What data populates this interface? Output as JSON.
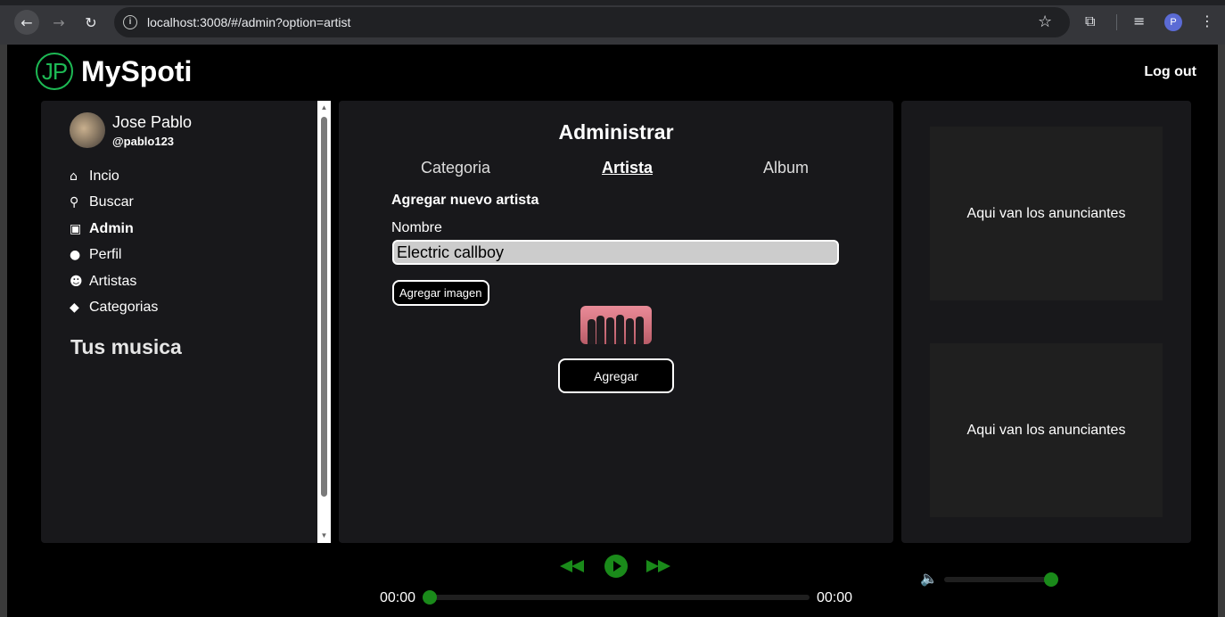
{
  "browser": {
    "url": "localhost:3008/#/admin?option=artist",
    "profile_initial": "P"
  },
  "app": {
    "title": "MySpoti",
    "logo_text": "JP",
    "logout_label": "Log out"
  },
  "user": {
    "name": "Jose Pablo",
    "handle": "@pablo123"
  },
  "sidebar": {
    "items": [
      {
        "label": "Incio",
        "icon": "home-icon",
        "glyph": "⌂",
        "active": false
      },
      {
        "label": "Buscar",
        "icon": "search-icon",
        "glyph": "⚲",
        "active": false
      },
      {
        "label": "Admin",
        "icon": "briefcase-icon",
        "glyph": "▣",
        "active": true
      },
      {
        "label": "Perfil",
        "icon": "user-circle-icon",
        "glyph": "●",
        "active": false
      },
      {
        "label": "Artistas",
        "icon": "users-icon",
        "glyph": "☻",
        "active": false
      },
      {
        "label": "Categorias",
        "icon": "tag-icon",
        "glyph": "◆",
        "active": false
      }
    ],
    "section_title": "Tus musica"
  },
  "admin": {
    "title": "Administrar",
    "tabs": [
      {
        "label": "Categoria",
        "active": false
      },
      {
        "label": "Artista",
        "active": true
      },
      {
        "label": "Album",
        "active": false
      }
    ],
    "form_title": "Agregar nuevo artista",
    "name_label": "Nombre",
    "name_value": "Electric callboy",
    "add_image_label": "Agregar imagen",
    "submit_label": "Agregar"
  },
  "ads": {
    "text_1": "Aqui van los anunciantes",
    "text_2": "Aqui van los anunciantes"
  },
  "player": {
    "current_time": "00:00",
    "total_time": "00:00",
    "progress": 0,
    "volume": 1.0,
    "accent_color": "#1a8a1a"
  }
}
